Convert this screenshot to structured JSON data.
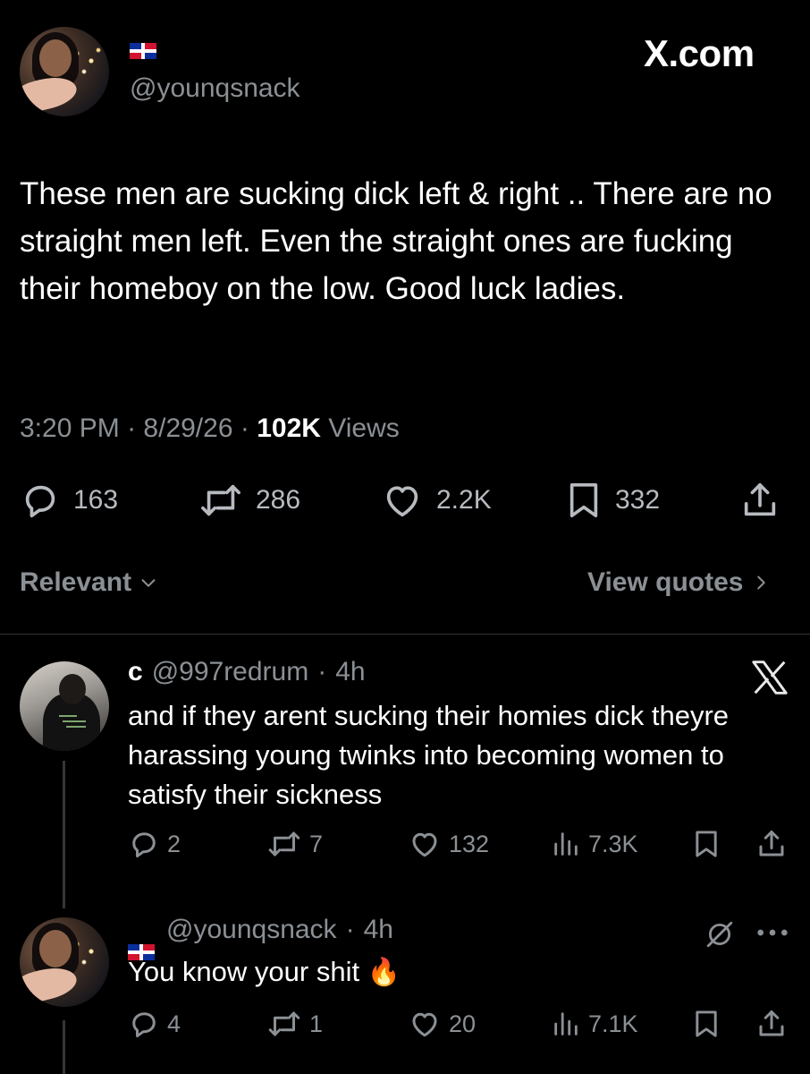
{
  "main_tweet": {
    "handle": "@younqsnack",
    "brand": "X.com",
    "text": "These men are sucking dick left & right .. There are no straight men left. Even the straight ones are fucking their homeboy on the low. Good luck ladies.",
    "time": "3:20 PM",
    "date": "8/29/26",
    "views_count": "102K",
    "views_label": "Views",
    "separator": "·",
    "stats": {
      "replies": "163",
      "reposts": "286",
      "likes": "2.2K",
      "bookmarks": "332"
    }
  },
  "sort": {
    "label": "Relevant",
    "view_quotes": "View quotes"
  },
  "replies": [
    {
      "name": "c",
      "handle": "@997redrum",
      "time": "4h",
      "text": "and if they arent sucking their homies dick theyre harassing young twinks into becoming women to satisfy their sickness",
      "stats": {
        "replies": "2",
        "reposts": "7",
        "likes": "132",
        "views": "7.3K"
      }
    },
    {
      "handle": "@younqsnack",
      "time": "4h",
      "text": "You know your shit",
      "emoji": "🔥",
      "stats": {
        "replies": "4",
        "reposts": "1",
        "likes": "20",
        "views": "7.1K"
      }
    }
  ],
  "icons": {
    "flag": "dominican-republic-flag-icon",
    "reply": "reply-icon",
    "repost": "repost-icon",
    "like": "heart-icon",
    "bookmark": "bookmark-icon",
    "share": "share-icon",
    "views": "views-icon",
    "x_logo": "x-logo-icon",
    "more": "more-icon",
    "grok": "grok-icon"
  },
  "colors": {
    "background": "#000000",
    "text": "#ffffff",
    "muted": "#8b9095",
    "divider": "#2f3336"
  }
}
